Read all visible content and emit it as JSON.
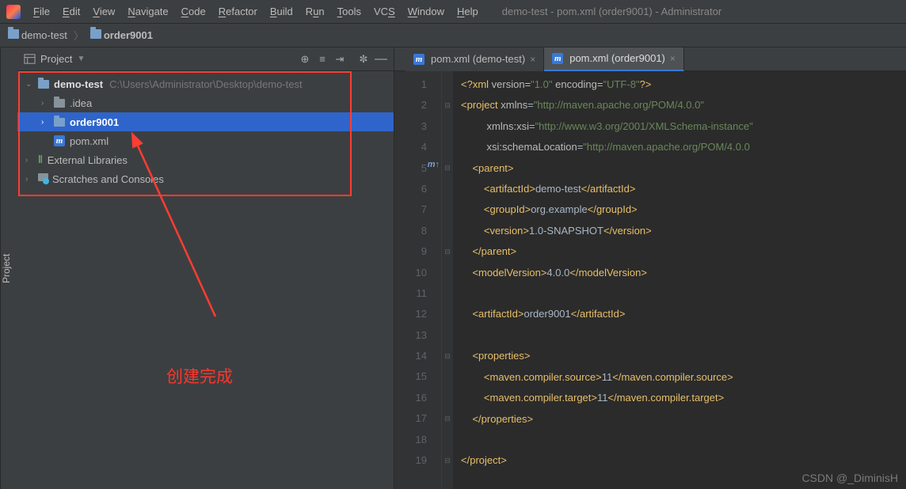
{
  "window_title": "demo-test - pom.xml (order9001) - Administrator",
  "menu": {
    "file": "File",
    "edit": "Edit",
    "view": "View",
    "navigate": "Navigate",
    "code": "Code",
    "refactor": "Refactor",
    "build": "Build",
    "run": "Run",
    "tools": "Tools",
    "vcs": "VCS",
    "window": "Window",
    "help": "Help"
  },
  "breadcrumb": {
    "root": "demo-test",
    "child": "order9001"
  },
  "side_label": "Project",
  "project_header": {
    "title": "Project"
  },
  "tree": {
    "root": {
      "name": "demo-test",
      "path": "C:\\Users\\Administrator\\Desktop\\demo-test"
    },
    "idea": ".idea",
    "order": "order9001",
    "pom": "pom.xml",
    "ext": "External Libraries",
    "scratch": "Scratches and Consoles"
  },
  "annotation": "创建完成",
  "tabs": [
    {
      "label": "pom.xml (demo-test)",
      "active": false
    },
    {
      "label": "pom.xml (order9001)",
      "active": true
    }
  ],
  "code": {
    "lines": [
      "1",
      "2",
      "3",
      "4",
      "5",
      "6",
      "7",
      "8",
      "9",
      "10",
      "11",
      "12",
      "13",
      "14",
      "15",
      "16",
      "17",
      "18",
      "19"
    ],
    "l1_pre": "<?xml ",
    "l1_a1": "version",
    "l1_v1": "\"1.0\"",
    "l1_a2": "encoding",
    "l1_v2": "\"UTF-8\"",
    "l1_post": "?>",
    "l2_tag": "project",
    "l2_a": "xmlns",
    "l2_v": "\"http://maven.apache.org/POM/4.0.0\"",
    "l3_a": "xmlns:xsi",
    "l3_v": "\"http://www.w3.org/2001/XMLSchema-instance\"",
    "l4_a": "xsi:schemaLocation",
    "l4_v": "\"http://maven.apache.org/POM/4.0.0",
    "l5": "parent",
    "l6_tag": "artifactId",
    "l6_val": "demo-test",
    "l7_tag": "groupId",
    "l7_val": "org.example",
    "l8_tag": "version",
    "l8_val": "1.0-SNAPSHOT",
    "l9": "parent",
    "l10_tag": "modelVersion",
    "l10_val": "4.0.0",
    "l12_tag": "artifactId",
    "l12_val": "order9001",
    "l14": "properties",
    "l15_tag": "maven.compiler.source",
    "l15_val": "11",
    "l16_tag": "maven.compiler.target",
    "l16_val": "11",
    "l17": "properties",
    "l19": "project"
  },
  "watermark": "CSDN @_DiminisH"
}
